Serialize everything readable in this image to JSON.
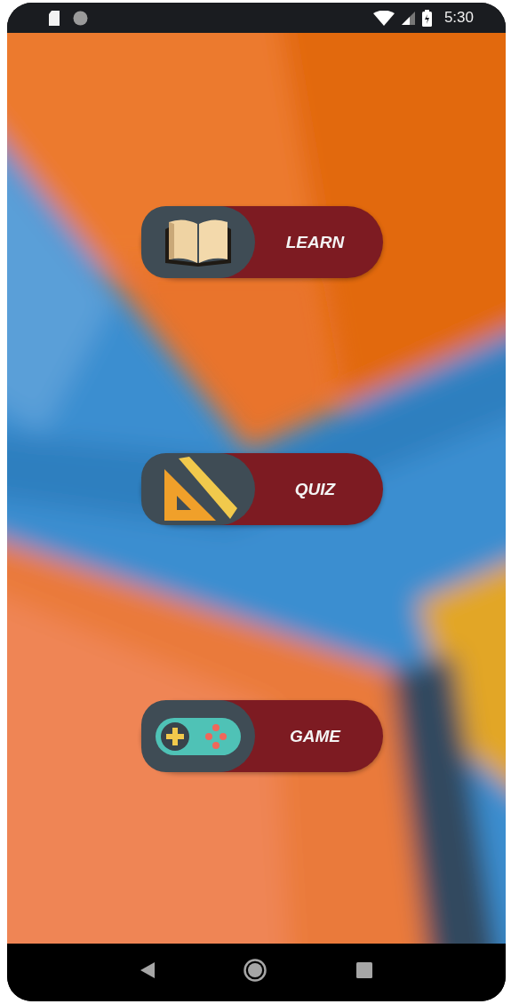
{
  "status_bar": {
    "time": "5:30"
  },
  "menu_buttons": [
    {
      "label": "LEARN",
      "kind": "book"
    },
    {
      "label": "QUIZ",
      "kind": "ruler"
    },
    {
      "label": "GAME",
      "kind": "gamepad"
    }
  ]
}
